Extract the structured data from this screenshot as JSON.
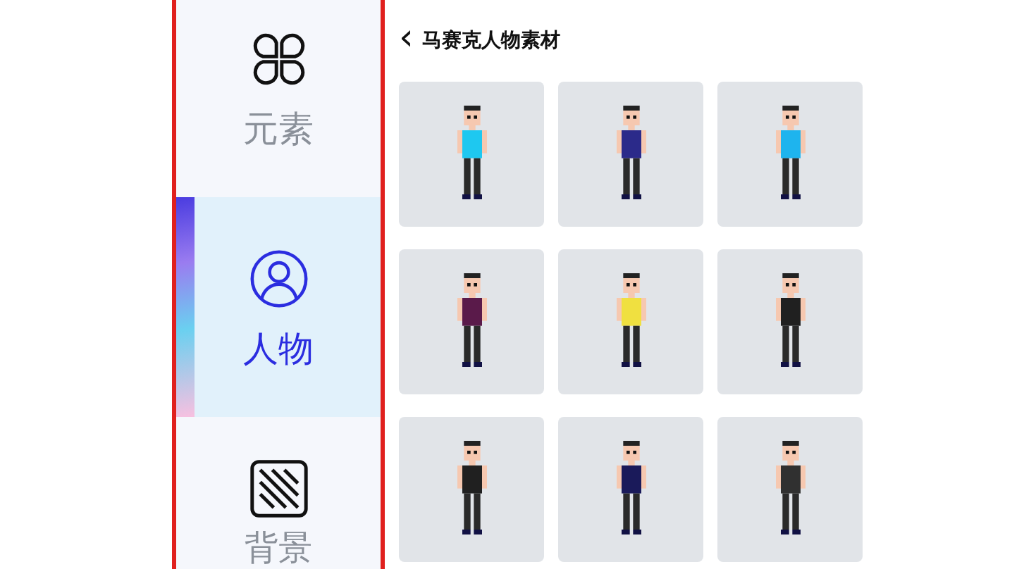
{
  "sidebar": {
    "items": [
      {
        "kind": "elements",
        "label": "元素",
        "selected": false
      },
      {
        "kind": "person",
        "label": "人物",
        "selected": true
      },
      {
        "kind": "background",
        "label": "背景",
        "selected": false
      }
    ]
  },
  "header": {
    "back_icon": "‹",
    "title": "马赛克人物素材"
  },
  "characters": [
    {
      "color": "#1ec8f0"
    },
    {
      "color": "#2b2a8a"
    },
    {
      "color": "#1eb4ee"
    },
    {
      "color": "#5a1a4a"
    },
    {
      "color": "#f0e040"
    },
    {
      "color": "#202020"
    },
    {
      "color": "#202020"
    },
    {
      "color": "#1a1a5a"
    },
    {
      "color": "#303030"
    }
  ]
}
